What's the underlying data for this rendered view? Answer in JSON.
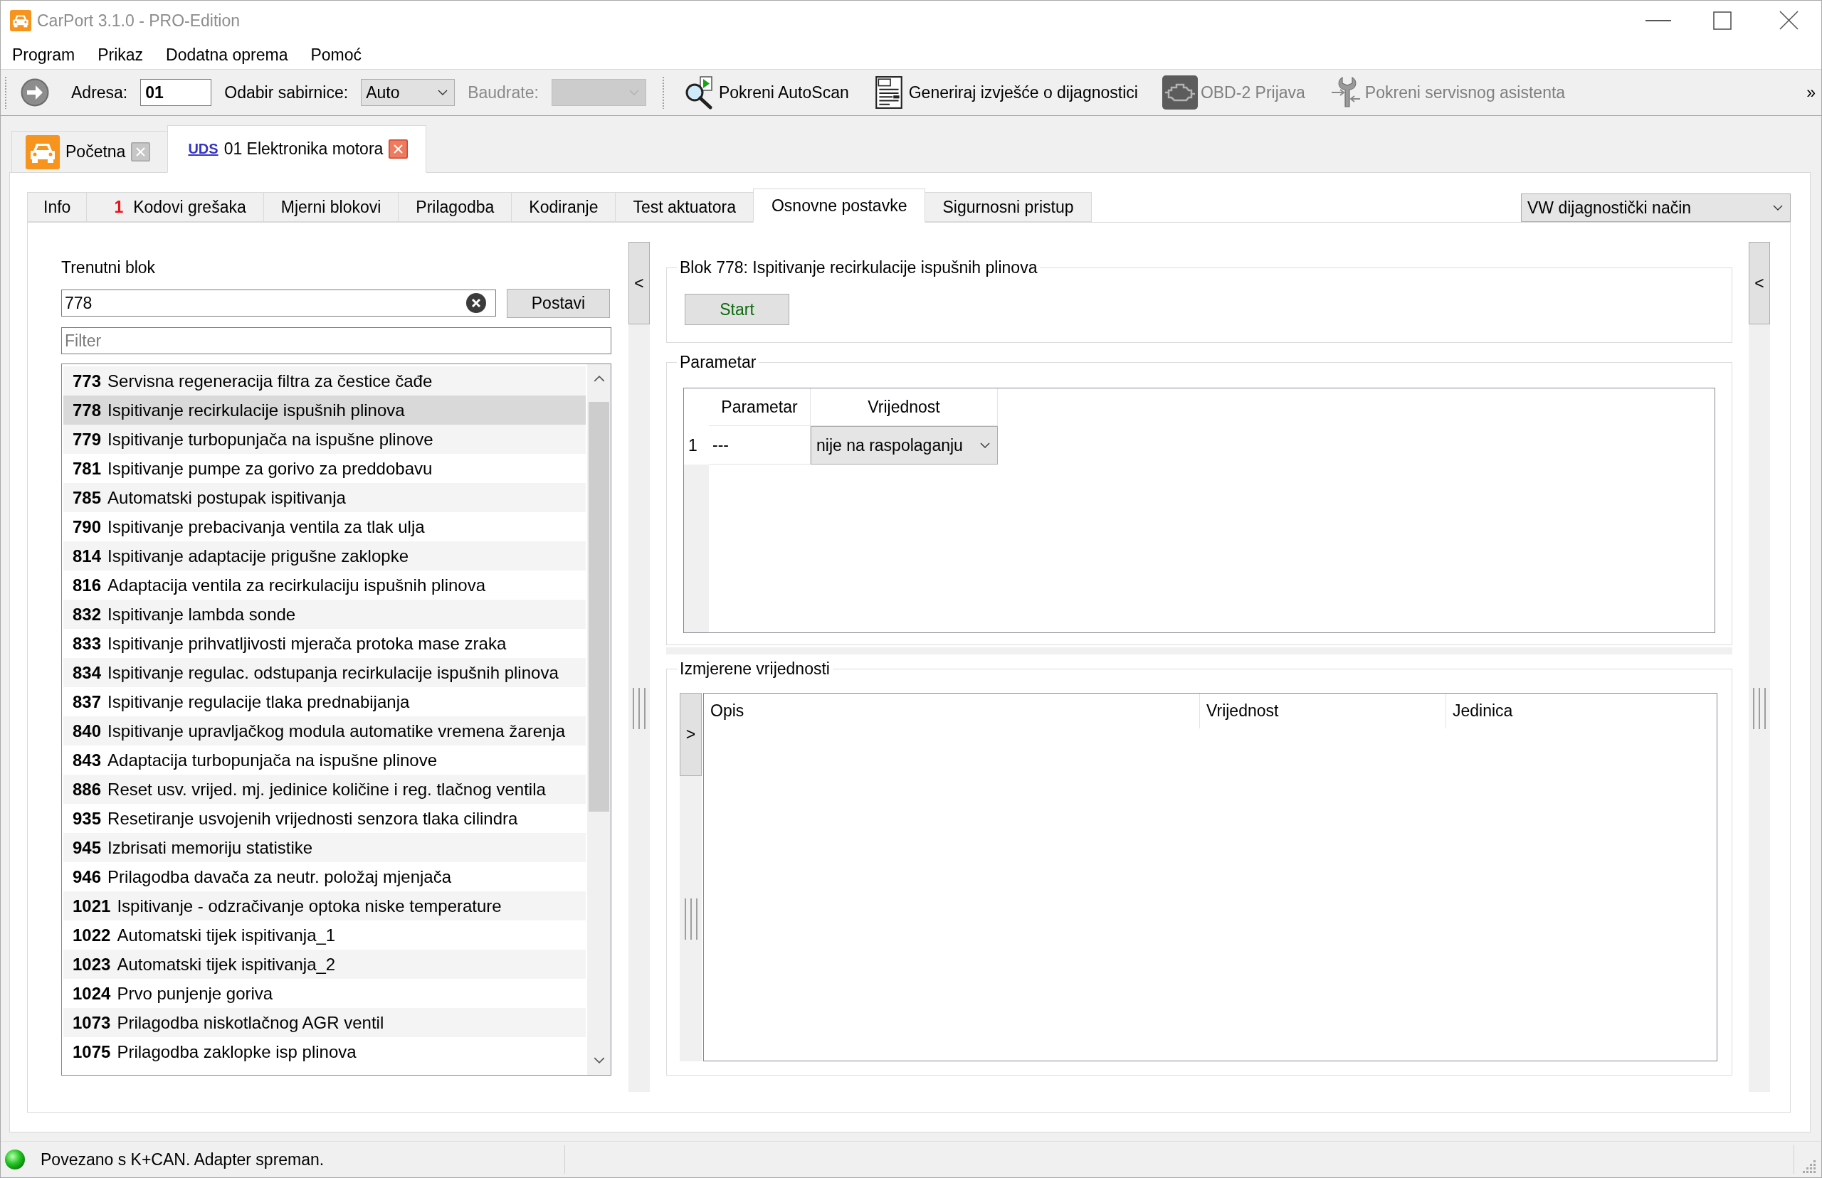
{
  "window": {
    "title": "CarPort 3.1.0 - PRO-Edition"
  },
  "menu": [
    {
      "label": "Program"
    },
    {
      "label": "Prikaz"
    },
    {
      "label": "Dodatna oprema"
    },
    {
      "label": "Pomoć"
    }
  ],
  "toolbar": {
    "address": {
      "label": "Adresa:",
      "value": "01"
    },
    "bus": {
      "label": "Odabir sabirnice:",
      "value": "Auto"
    },
    "baudrate": {
      "label": "Baudrate:",
      "disabled": true
    },
    "actions": [
      {
        "kind": "autoscan",
        "label": "Pokreni AutoScan",
        "disabled": false
      },
      {
        "kind": "report",
        "label": "Generiraj izvješće o dijagnostici",
        "disabled": false
      },
      {
        "kind": "engine",
        "label": "OBD-2 Prijava",
        "disabled": true
      },
      {
        "kind": "service",
        "label": "Pokreni servisnog asistenta",
        "disabled": true
      }
    ],
    "overflow": "»"
  },
  "document_tabs": [
    {
      "kind": "home",
      "label": "Početna",
      "selected": false
    },
    {
      "kind": "module",
      "protocol": "UDS",
      "label": "01 Elektronika motora",
      "selected": true
    }
  ],
  "tabs": [
    {
      "label": "Info",
      "selected": false
    },
    {
      "label": "Kodovi grešaka",
      "count": "1",
      "selected": false
    },
    {
      "label": "Mjerni blokovi",
      "selected": false
    },
    {
      "label": "Prilagodba",
      "selected": false
    },
    {
      "label": "Kodiranje",
      "selected": false
    },
    {
      "label": "Test aktuatora",
      "selected": false
    },
    {
      "label": "Osnovne postavke",
      "selected": true
    },
    {
      "label": "Sigurnosni pristup",
      "selected": false
    }
  ],
  "mode_select": {
    "value": "VW dijagnostički način"
  },
  "block_panel": {
    "label": "Trenutni blok",
    "value": "778",
    "set_button": "Postavi",
    "filter": {
      "placeholder": "Filter"
    },
    "blocks": [
      {
        "number": "773",
        "name": "Servisna regeneracija filtra za čestice čađe",
        "selected": false
      },
      {
        "number": "778",
        "name": "Ispitivanje recirkulacije ispušnih plinova",
        "selected": true
      },
      {
        "number": "779",
        "name": "Ispitivanje turbopunjača na ispušne plinove",
        "selected": false
      },
      {
        "number": "781",
        "name": "Ispitivanje pumpe za gorivo za preddobavu",
        "selected": false
      },
      {
        "number": "785",
        "name": "Automatski postupak ispitivanja",
        "selected": false
      },
      {
        "number": "790",
        "name": "Ispitivanje prebacivanja ventila za tlak ulja",
        "selected": false
      },
      {
        "number": "814",
        "name": "Ispitivanje adaptacije prigušne zaklopke",
        "selected": false
      },
      {
        "number": "816",
        "name": "Adaptacija ventila za recirkulaciju ispušnih plinova",
        "selected": false
      },
      {
        "number": "832",
        "name": "Ispitivanje lambda sonde",
        "selected": false
      },
      {
        "number": "833",
        "name": "Ispitivanje prihvatljivosti mjerača protoka mase zraka",
        "selected": false
      },
      {
        "number": "834",
        "name": "Ispitivanje regulac. odstupanja recirkulacije ispušnih plinova",
        "selected": false
      },
      {
        "number": "837",
        "name": "Ispitivanje regulacije tlaka prednabijanja",
        "selected": false
      },
      {
        "number": "840",
        "name": "Ispitivanje upravljačkog modula automatike vremena žarenja",
        "selected": false
      },
      {
        "number": "843",
        "name": "Adaptacija turbopunjača na ispušne plinove",
        "selected": false
      },
      {
        "number": "886",
        "name": "Reset usv. vrijed. mj. jedinice količine i reg. tlačnog ventila",
        "selected": false
      },
      {
        "number": "935",
        "name": "Resetiranje usvojenih vrijednosti senzora tlaka cilindra",
        "selected": false
      },
      {
        "number": "945",
        "name": "Izbrisati memoriju statistike",
        "selected": false
      },
      {
        "number": "946",
        "name": "Prilagodba davača za neutr. položaj mjenjača",
        "selected": false
      },
      {
        "number": "1021",
        "name": "Ispitivanje - odzračivanje optoka niske temperature",
        "selected": false
      },
      {
        "number": "1022",
        "name": "Automatski tijek ispitivanja_1",
        "selected": false
      },
      {
        "number": "1023",
        "name": "Automatski tijek ispitivanja_2",
        "selected": false
      },
      {
        "number": "1024",
        "name": "Prvo punjenje goriva",
        "selected": false
      },
      {
        "number": "1073",
        "name": "Prilagodba niskotlačnog AGR ventil",
        "selected": false
      },
      {
        "number": "1075",
        "name": "Prilagodba zaklopke isp plinova",
        "selected": false
      }
    ]
  },
  "left_splitter": {
    "button": "<"
  },
  "block_group": {
    "title": "Blok 778: Ispitivanje recirkulacije ispušnih plinova",
    "start_button": "Start"
  },
  "parameter_group": {
    "title": "Parametar",
    "columns": [
      "Parametar",
      "Vrijednost"
    ],
    "rows": [
      {
        "index": "1",
        "parameter": "---",
        "value": "nije na raspolaganju"
      }
    ]
  },
  "measured_group": {
    "title": "Izmjerene vrijednosti",
    "expand_button": ">",
    "columns": [
      "Opis",
      "Vrijednost",
      "Jedinica"
    ]
  },
  "right_splitter": {
    "button": "<"
  },
  "status_bar": {
    "connected": true,
    "text": "Povezano s K+CAN. Adapter spreman."
  }
}
